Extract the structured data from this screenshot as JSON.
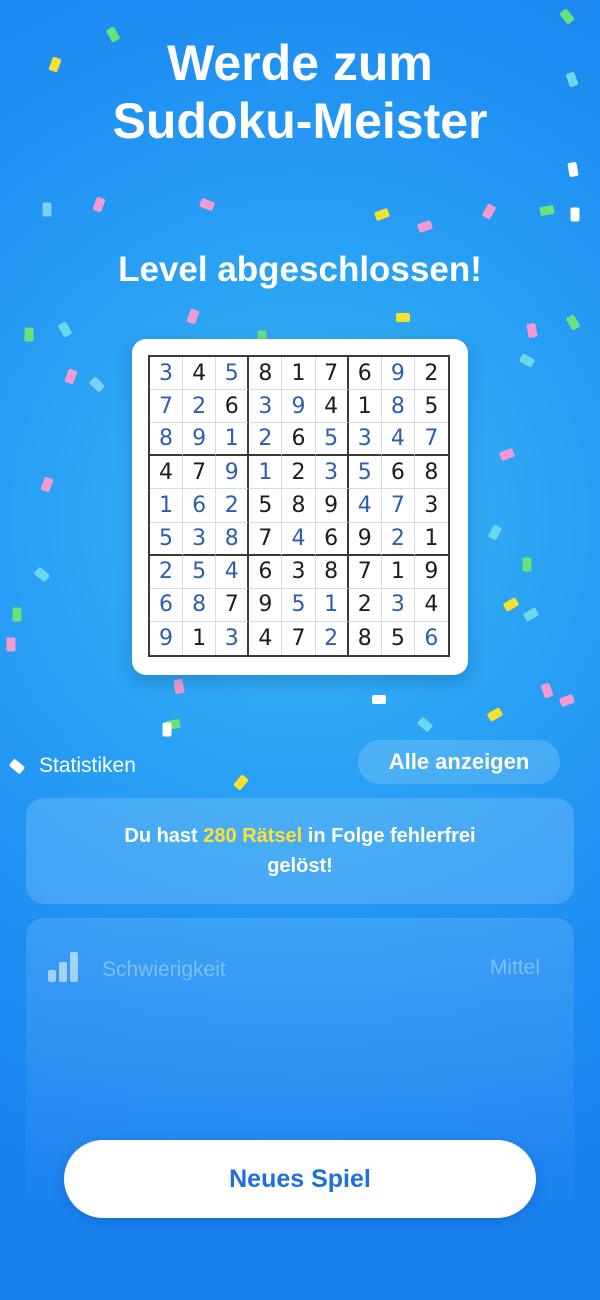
{
  "headline": {
    "line1": "Werde zum",
    "line2": "Sudoku-Meister"
  },
  "subheadline": "Level abgeschlossen!",
  "board": {
    "rows": [
      [
        3,
        4,
        5,
        8,
        1,
        7,
        6,
        9,
        2
      ],
      [
        7,
        2,
        6,
        3,
        9,
        4,
        1,
        8,
        5
      ],
      [
        8,
        9,
        1,
        2,
        6,
        5,
        3,
        4,
        7
      ],
      [
        4,
        7,
        9,
        1,
        2,
        3,
        5,
        6,
        8
      ],
      [
        1,
        6,
        2,
        5,
        8,
        9,
        4,
        7,
        3
      ],
      [
        5,
        3,
        8,
        7,
        4,
        6,
        9,
        2,
        1
      ],
      [
        2,
        5,
        4,
        6,
        3,
        8,
        7,
        1,
        9
      ],
      [
        6,
        8,
        7,
        9,
        5,
        1,
        2,
        3,
        4
      ],
      [
        9,
        1,
        3,
        4,
        7,
        2,
        8,
        5,
        6
      ]
    ],
    "user_filled": [
      [
        1,
        0,
        1,
        0,
        0,
        0,
        0,
        1,
        0
      ],
      [
        1,
        1,
        0,
        1,
        1,
        0,
        0,
        1,
        0
      ],
      [
        1,
        1,
        1,
        1,
        0,
        1,
        1,
        1,
        1
      ],
      [
        0,
        0,
        1,
        1,
        0,
        1,
        1,
        0,
        0
      ],
      [
        1,
        1,
        1,
        0,
        0,
        0,
        1,
        1,
        0
      ],
      [
        1,
        1,
        1,
        0,
        1,
        0,
        0,
        1,
        0
      ],
      [
        1,
        1,
        1,
        0,
        0,
        0,
        0,
        0,
        0
      ],
      [
        1,
        1,
        0,
        0,
        1,
        1,
        0,
        1,
        0
      ],
      [
        1,
        0,
        1,
        0,
        0,
        1,
        0,
        0,
        1
      ]
    ],
    "colors": {
      "given": "#1d1d1d",
      "user": "#2d5fae"
    }
  },
  "stats": {
    "label": "Statistiken",
    "show_all_label": "Alle anzeigen",
    "streak": {
      "prefix": "Du hast ",
      "highlight": "280 Rätsel",
      "suffix": " in Folge fehlerfrei gelöst!",
      "highlight_color": "#ffe035"
    },
    "difficulty": {
      "icon": "signal-bars-icon",
      "label": "Schwierigkeit",
      "value": "Mittel"
    }
  },
  "new_game_label": "Neues Spiel",
  "theme": {
    "background": "#2aa3f4",
    "button_text": "#1d6fdc"
  }
}
